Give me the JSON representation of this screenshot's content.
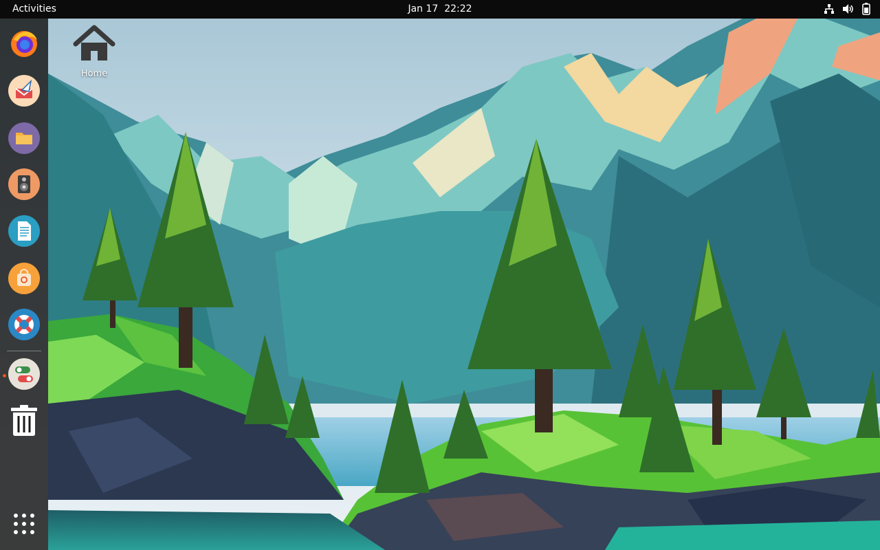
{
  "topbar": {
    "activities_label": "Activities",
    "date": "Jan 17",
    "time": "22:22",
    "tray_icons": [
      "network-icon",
      "volume-icon",
      "battery-icon"
    ]
  },
  "dock": {
    "apps": [
      {
        "name": "firefox",
        "icon": "firefox-icon"
      },
      {
        "name": "mail",
        "icon": "mail-client-icon"
      },
      {
        "name": "files",
        "icon": "files-folder-icon"
      },
      {
        "name": "music",
        "icon": "speaker-music-icon"
      },
      {
        "name": "text-editor",
        "icon": "text-document-icon"
      },
      {
        "name": "software",
        "icon": "ubuntu-software-icon"
      },
      {
        "name": "help",
        "icon": "lifebuoy-help-icon"
      },
      {
        "name": "toggles",
        "icon": "toggle-settings-icon"
      },
      {
        "name": "trash",
        "icon": "trash-icon"
      }
    ],
    "show_apps_icon": "apps-grid-icon",
    "running_indicator_color": "#e95420"
  },
  "desktop": {
    "home_label": "Home",
    "home_icon": "home-icon"
  },
  "colors": {
    "topbar_bg": "#0b0b0b",
    "dock_bg": "#141414",
    "accent": "#e95420"
  }
}
